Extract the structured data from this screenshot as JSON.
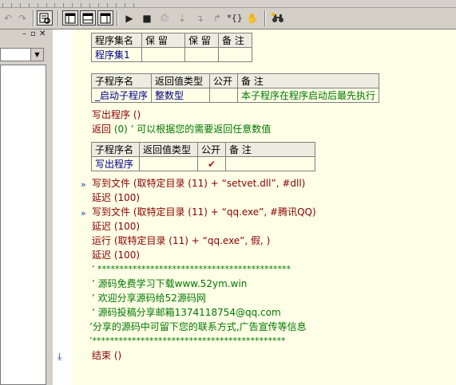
{
  "tables": {
    "assembly": {
      "headers": [
        "程序集名",
        "保 留",
        "保 留",
        "备 注"
      ],
      "row": [
        "程序集1",
        "",
        "",
        ""
      ]
    },
    "sub1": {
      "headers": [
        "子程序名",
        "返回值类型",
        "公开",
        "备 注"
      ],
      "row": [
        "_启动子程序",
        "整数型",
        "",
        "本子程序在程序启动后最先执行"
      ]
    },
    "sub2": {
      "headers": [
        "子程序名",
        "返回值类型",
        "公开",
        "备 注"
      ],
      "row": [
        "写出程序",
        "",
        "✔",
        ""
      ]
    }
  },
  "code": {
    "l1": "写出程序 ()",
    "l2_kw": "返回",
    "l2_rest": " (0)  ’ 可以根据您的需要返回任意数值",
    "l3": "写到文件 (取特定目录 (11) + “setvet.dll”, #dll)",
    "l4": "延迟 (100)",
    "l5": "写到文件 (取特定目录 (11) + “qq.exe”, #腾讯QQ)",
    "l6": "延迟 (100)",
    "l7": "运行 (取特定目录 (11) + “qq.exe”, 假, )",
    "l8": "延迟 (100)",
    "l9": "’ ********************************************",
    "l10": "’ 源码免费学习下载www.52ym.win",
    "l11": "’ 欢迎分享源码给52源码网",
    "l12": "’ 源码投稿分享邮箱1374118754@qq.com",
    "l13": "’分享的源码中可留下您的联系方式,广告宣传等信息",
    "l14": "’********************************************",
    "l15": "结束 ()"
  },
  "icons": {
    "run": "▶",
    "stop": "■",
    "marker": "»",
    "breakpoint": "⤓"
  }
}
